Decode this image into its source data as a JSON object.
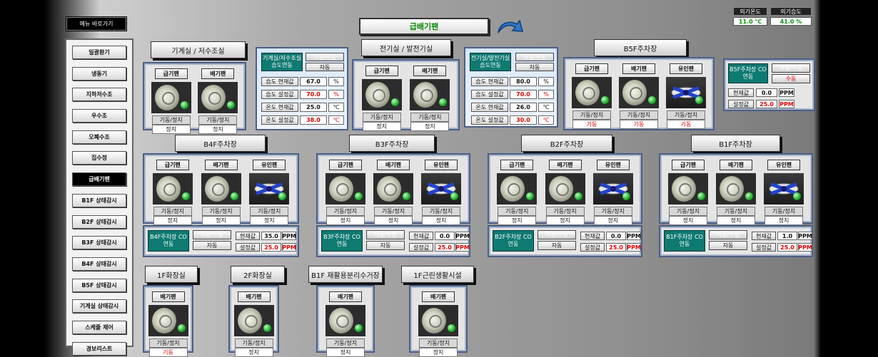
{
  "title": "급배기팬",
  "menu": {
    "title": "메뉴 바로가기",
    "items": [
      "일괄환기",
      "냉동기",
      "지하저수조",
      "우수조",
      "오폐수조",
      "집수정",
      "급배기팬",
      "B1F 상태감시",
      "B2F 상태감시",
      "B3F 상태감시",
      "B4F 상태감시",
      "B5F 상태감시",
      "기계실 상태감시",
      "스케쥴 제어",
      "경보리스트"
    ]
  },
  "outdoor": {
    "temp_label": "외기온도",
    "temp_value": "11.0 ℃",
    "hum_label": "외기습도",
    "hum_value": "41.0 %"
  },
  "common": {
    "supply": "급기팬",
    "exhaust": "배기팬",
    "induct": "유인팬",
    "ctl": "기동/정지",
    "stop": "정지",
    "run": "기동",
    "mode_label": "자동/수동",
    "auto": "자동",
    "manual": "수동",
    "cur_label": "현재값",
    "set_label": "설정값"
  },
  "groups": {
    "mech": {
      "label": "기계실 / 저수조실",
      "states": [
        "정지",
        "정지"
      ]
    },
    "elec": {
      "label": "전기실 / 발전기실",
      "states": [
        "정지",
        "정지"
      ]
    },
    "b5f": {
      "label": "B5F주차장",
      "states": [
        "기동",
        "기동",
        "기동"
      ]
    },
    "b4f": {
      "label": "B4F주차장",
      "states": [
        "정지",
        "정지",
        "정지"
      ]
    },
    "b3f": {
      "label": "B3F주차장",
      "states": [
        "정지",
        "정지",
        "정지"
      ]
    },
    "b2f": {
      "label": "B2F주차장",
      "states": [
        "정지",
        "정지",
        "정지"
      ]
    },
    "b1f": {
      "label": "B1F주차장",
      "states": [
        "정지",
        "정지",
        "정지"
      ]
    },
    "t1": {
      "label": "1F화장실",
      "states": [
        "기동"
      ]
    },
    "t2": {
      "label": "2F화장실",
      "states": [
        "정지"
      ]
    },
    "rec": {
      "label": "B1F 재활용분리수거장",
      "states": [
        "정지"
      ]
    },
    "life": {
      "label": "1F근린생활시설",
      "states": [
        "정지"
      ]
    }
  },
  "hum_mech": {
    "title": "기계실/저수조실 습도연동",
    "mode": "자동",
    "rows": [
      {
        "label": "습도 현재값",
        "value": "67.0",
        "unit": "%"
      },
      {
        "label": "습도 설정값",
        "value": "70.0",
        "unit": "%"
      },
      {
        "label": "온도 현재값",
        "value": "25.0",
        "unit": "℃"
      },
      {
        "label": "온도 설정값",
        "value": "38.0",
        "unit": "℃"
      }
    ]
  },
  "hum_elec": {
    "title": "전기실/발전기실 습도연동",
    "mode": "자동",
    "rows": [
      {
        "label": "습도 현재값",
        "value": "80.0",
        "unit": "%"
      },
      {
        "label": "습도 설정값",
        "value": "70.0",
        "unit": "%"
      },
      {
        "label": "온도 현재값",
        "value": "26.0",
        "unit": "℃"
      },
      {
        "label": "온도 설정값",
        "value": "30.0",
        "unit": "℃"
      }
    ]
  },
  "co": {
    "b5f": {
      "title": "B5F주차장 CO연동",
      "mode": "수동",
      "cur": "0.0",
      "set": "25.0",
      "unit": "PPM"
    },
    "b4f": {
      "title": "B4F주차장 CO연동",
      "mode": "자동",
      "cur": "35.0",
      "set": "25.0",
      "unit": "PPM"
    },
    "b3f": {
      "title": "B3F주차장 CO연동",
      "mode": "자동",
      "cur": "0.0",
      "set": "25.0",
      "unit": "PPM"
    },
    "b2f": {
      "title": "B2F주차장 CO연동",
      "mode": "자동",
      "cur": "0.0",
      "set": "25.0",
      "unit": "PPM"
    },
    "b1f": {
      "title": "B1F주차장 CO연동",
      "mode": "자동",
      "cur": "1.0",
      "set": "25.0",
      "unit": "PPM"
    }
  },
  "colors": {
    "accent_green": "#0a8a0a",
    "teal": "#0e7a72",
    "alarm_red": "#dd0000"
  }
}
